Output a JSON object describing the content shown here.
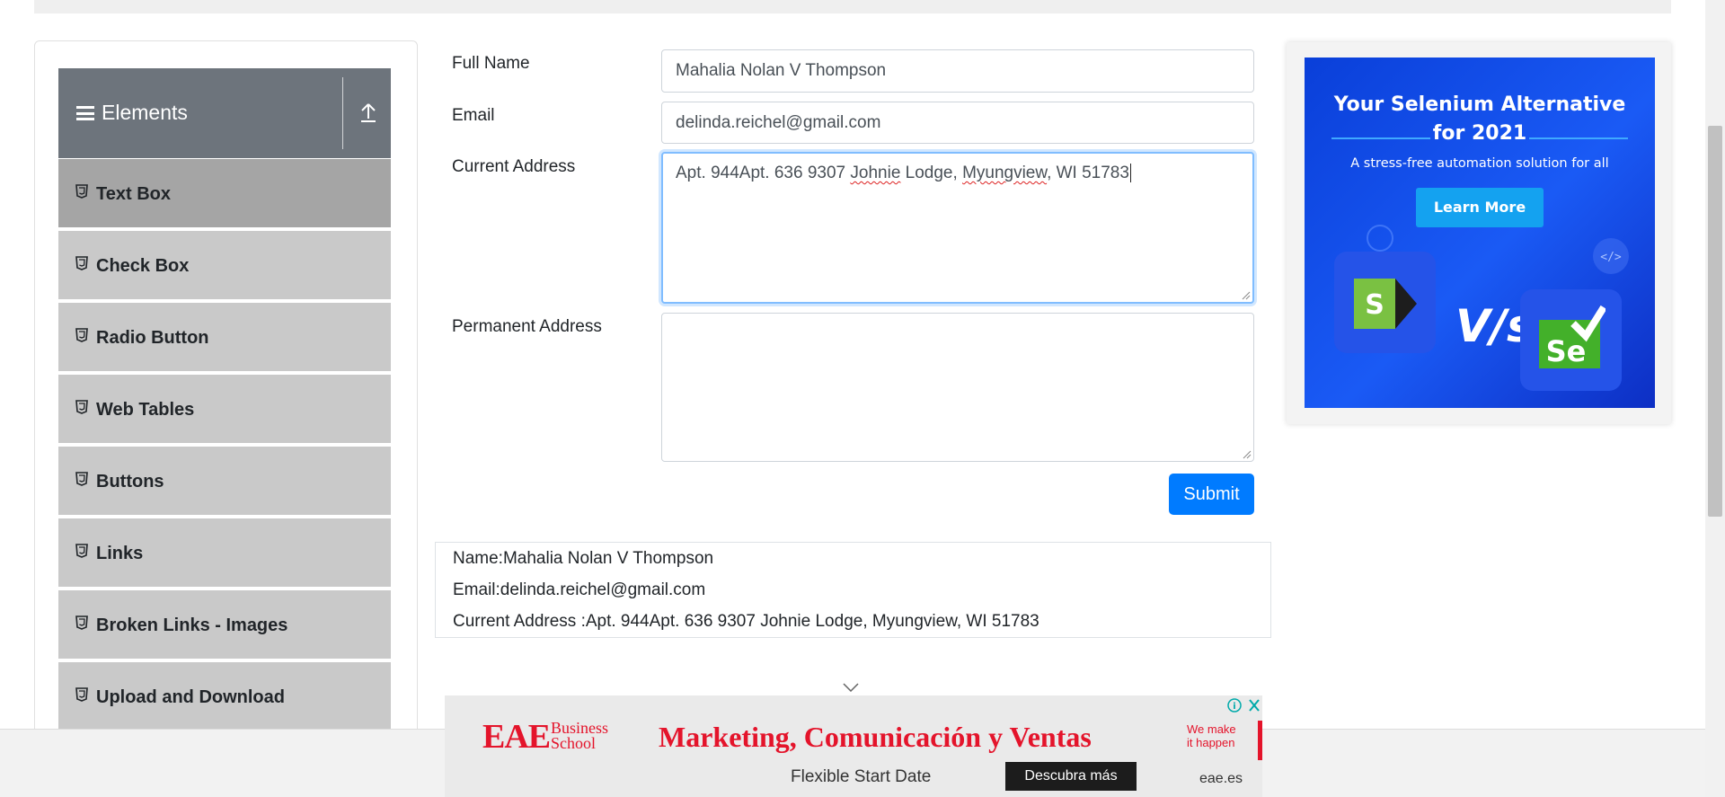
{
  "sidebar": {
    "header": "Elements",
    "items": [
      {
        "label": "Text Box"
      },
      {
        "label": "Check Box"
      },
      {
        "label": "Radio Button"
      },
      {
        "label": "Web Tables"
      },
      {
        "label": "Buttons"
      },
      {
        "label": "Links"
      },
      {
        "label": "Broken Links - Images"
      },
      {
        "label": "Upload and Download"
      }
    ]
  },
  "form": {
    "full_name_label": "Full Name",
    "full_name_value": "Mahalia Nolan V Thompson",
    "email_label": "Email",
    "email_value": "delinda.reichel@gmail.com",
    "current_address_label": "Current Address",
    "current_address_parts": [
      "Apt. 944Apt. 636 9307 ",
      "Johnie",
      " Lodge, ",
      "Myungview",
      ", WI 51783"
    ],
    "permanent_address_label": "Permanent Address",
    "permanent_address_value": "",
    "submit_label": "Submit"
  },
  "output": {
    "name": "Name:Mahalia Nolan V Thompson",
    "email": "Email:delinda.reichel@gmail.com",
    "current_address": "Current Address :Apt. 944Apt. 636 9307 Johnie Lodge, Myungview, WI 51783"
  },
  "ad_right": {
    "headline_1": "Your Selenium Alternative",
    "headline_2": "for 2021",
    "subline": "A stress-free automation solution for all",
    "cta": "Learn More",
    "vs": "V/s",
    "logo_left": "S",
    "logo_right": "Se"
  },
  "ad_bottom": {
    "brand": "EAE",
    "brand_sub_1": "Business",
    "brand_sub_2": "School",
    "headline": "Marketing, Comunicación y Ventas",
    "tagline_1": "We make",
    "tagline_2": "it happen",
    "sub": "Flexible Start Date",
    "cta": "Descubra más",
    "site": "eae.es"
  },
  "colors": {
    "primary": "#007bff",
    "sidebar_header": "#6d747c",
    "menu_item": "#c9c9c9",
    "menu_item_active": "#a5a5a5",
    "ad_red": "#e4142b",
    "ad_blue": "#1a5af5"
  },
  "icons": [
    "hamburger-icon",
    "collapse-up-icon",
    "html5-icon",
    "chevron-down-icon",
    "adchoices-icon",
    "close-icon"
  ]
}
